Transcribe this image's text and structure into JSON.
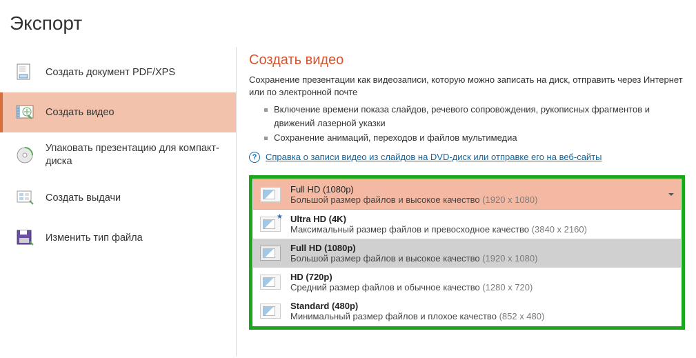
{
  "page_title": "Экспорт",
  "sidebar": {
    "items": [
      {
        "label": "Создать документ PDF/XPS"
      },
      {
        "label": "Создать видео"
      },
      {
        "label": "Упаковать презентацию для компакт-диска"
      },
      {
        "label": "Создать выдачи"
      },
      {
        "label": "Изменить тип файла"
      }
    ]
  },
  "main": {
    "title": "Создать видео",
    "intro": "Сохранение презентации как видеозаписи, которую можно записать на диск, отправить через Интернет или по электронной почте",
    "bullets": [
      "Включение времени показа слайдов, речевого сопровождения, рукописных фрагментов и движений лазерной указки",
      "Сохранение анимаций, переходов и файлов мультимедиа"
    ],
    "help_link": "Справка о записи видео из слайдов на DVD-диск или отправке его на веб-сайты"
  },
  "quality": {
    "selected": {
      "title": "Full HD (1080p)",
      "desc": "Большой размер файлов и высокое качество",
      "res": "(1920 x 1080)"
    },
    "options": [
      {
        "title": "Ultra HD (4K)",
        "desc": "Максимальный размер файлов и превосходное качество",
        "res": "(3840 x 2160)",
        "star": true
      },
      {
        "title": "Full HD (1080p)",
        "desc": "Большой размер файлов и высокое качество",
        "res": "(1920 x 1080)",
        "active": true
      },
      {
        "title": "HD (720p)",
        "desc": "Средний размер файлов и обычное качество",
        "res": "(1280 x 720)"
      },
      {
        "title": "Standard (480p)",
        "desc": "Минимальный размер файлов и плохое качество",
        "res": "(852 x 480)"
      }
    ]
  }
}
